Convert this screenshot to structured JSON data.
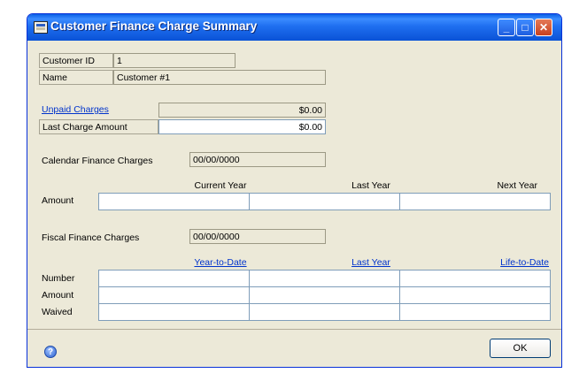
{
  "window": {
    "title": "Customer Finance Charge Summary"
  },
  "customer": {
    "id_label": "Customer ID",
    "id_value": "1",
    "name_label": "Name",
    "name_value": "Customer #1"
  },
  "charges": {
    "unpaid_label": "Unpaid Charges",
    "unpaid_value": "$0.00",
    "last_label": "Last Charge Amount",
    "last_value": "$0.00"
  },
  "calendar": {
    "label": "Calendar Finance Charges",
    "date": "00/00/0000",
    "headers": [
      "Current Year",
      "Last Year",
      "Next Year"
    ],
    "rows": [
      {
        "label": "Amount",
        "values": [
          "",
          "",
          ""
        ]
      }
    ]
  },
  "fiscal": {
    "label": "Fiscal Finance Charges",
    "date": "00/00/0000",
    "headers": [
      "Year-to-Date",
      "Last Year",
      "Life-to-Date"
    ],
    "rows": [
      {
        "label": "Number",
        "values": [
          "",
          "",
          ""
        ]
      },
      {
        "label": "Amount",
        "values": [
          "",
          "",
          ""
        ]
      },
      {
        "label": "Waived",
        "values": [
          "",
          "",
          ""
        ]
      }
    ]
  },
  "footer": {
    "ok_label": "OK"
  },
  "icons": {
    "help": "help-icon",
    "app": "window-app-icon"
  }
}
